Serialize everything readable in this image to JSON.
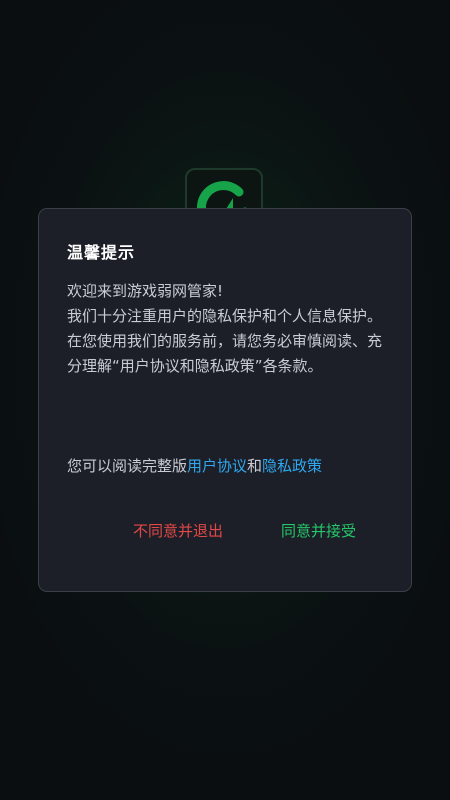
{
  "colors": {
    "background": "#0a0e10",
    "dialog_bg": "#1c1f27",
    "link": "#2fa8f0",
    "decline": "#e34848",
    "accept": "#25c76a",
    "logo_accent": "#16a34a"
  },
  "app_logo": {
    "icon": "lightning-ring-logo-icon"
  },
  "dialog": {
    "title": "温馨提示",
    "welcome": "欢迎来到游戏弱网管家!",
    "body": "我们十分注重用户的隐私保护和个人信息保护。在您使用我们的服务前，请您务必审慎阅读、充分理解“用户协议和隐私政策”各条款。",
    "policy_prefix": "您可以阅读完整版",
    "user_agreement_link": "用户协议",
    "policy_conjunction": "和",
    "privacy_policy_link": "隐私政策",
    "decline_label": "不同意并退出",
    "accept_label": "同意并接受"
  }
}
